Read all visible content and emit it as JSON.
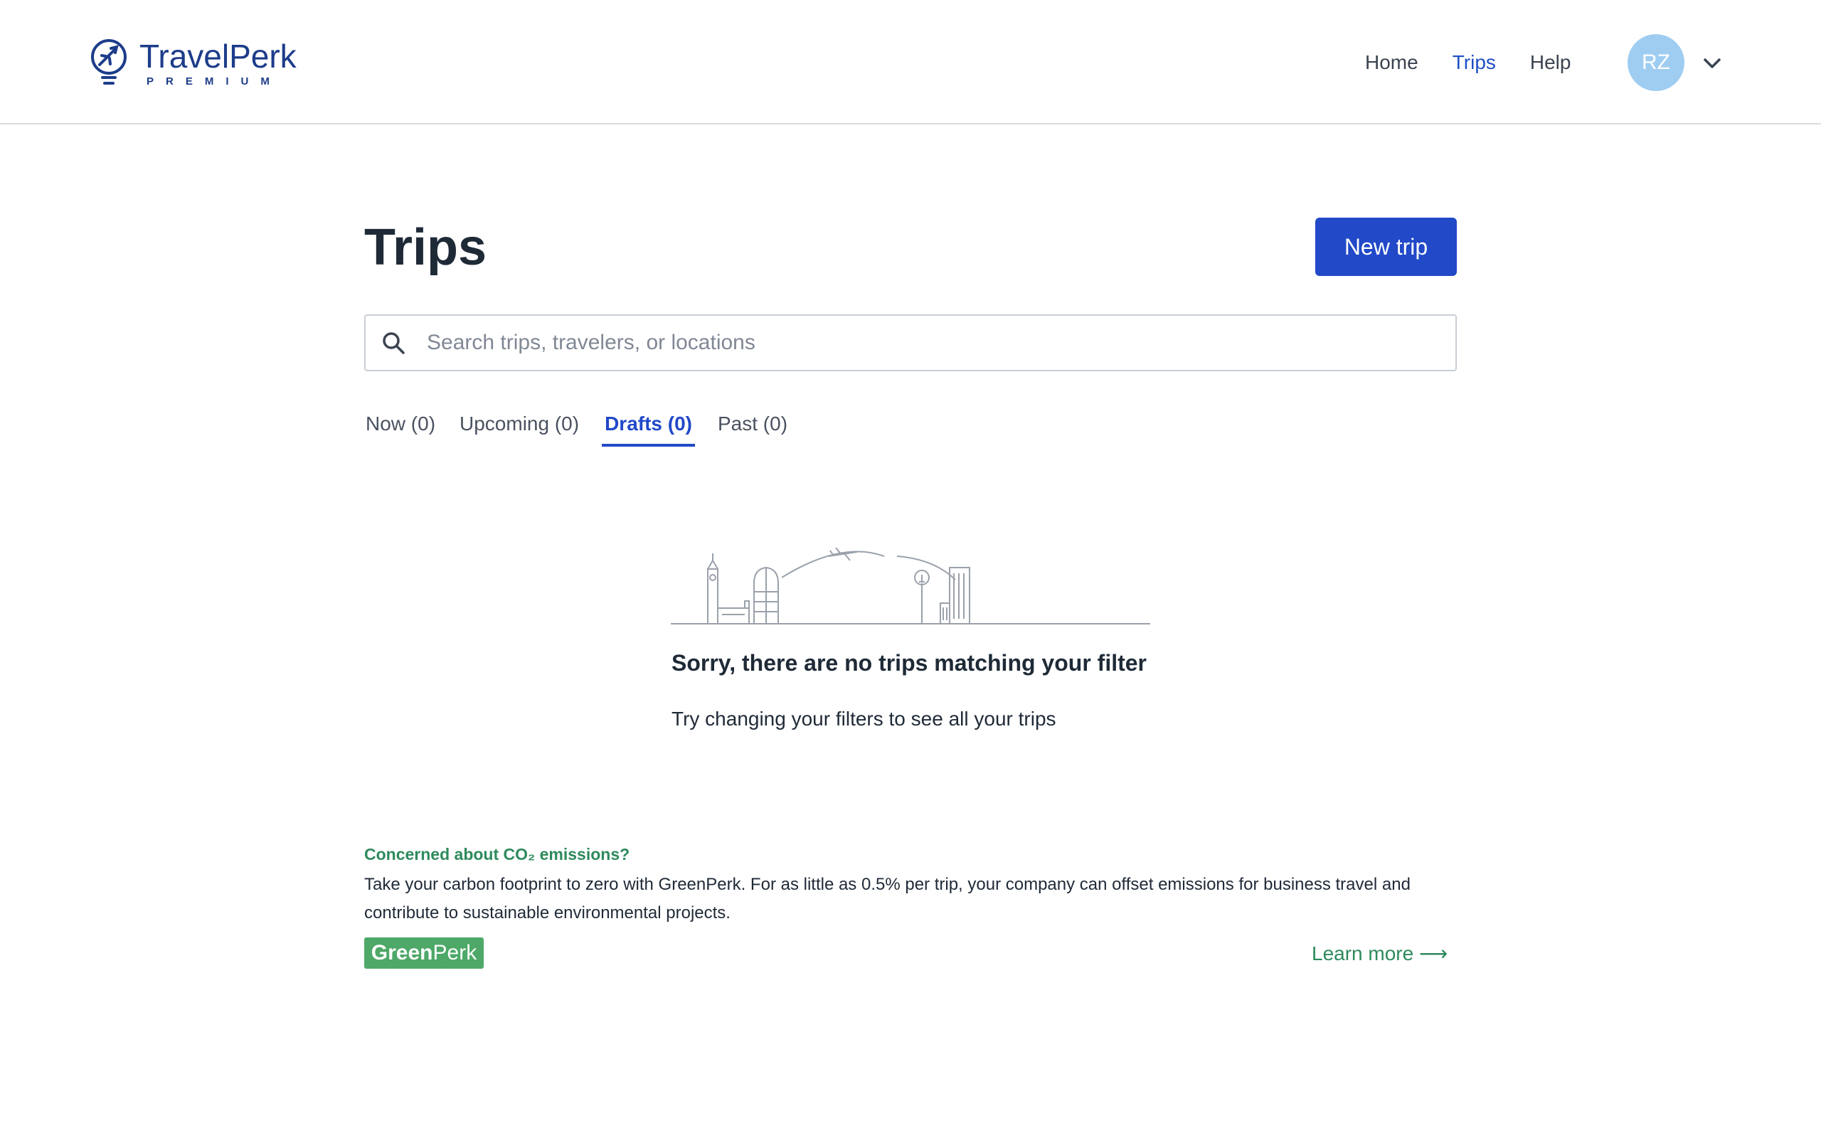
{
  "brand": {
    "name": "TravelPerk",
    "tier": "PREMIUM",
    "color": "#1d3c8a"
  },
  "nav": {
    "items": [
      {
        "label": "Home",
        "active": false
      },
      {
        "label": "Trips",
        "active": true
      },
      {
        "label": "Help",
        "active": false
      }
    ],
    "avatar_initials": "RZ",
    "avatar_color": "#9fcdf2"
  },
  "main": {
    "title": "Trips",
    "new_trip_label": "New trip",
    "search": {
      "placeholder": "Search trips, travelers, or locations",
      "value": ""
    },
    "tabs": [
      {
        "label": "Now (0)",
        "active": false
      },
      {
        "label": "Upcoming (0)",
        "active": false
      },
      {
        "label": "Drafts (0)",
        "active": true
      },
      {
        "label": "Past (0)",
        "active": false
      }
    ],
    "empty_state": {
      "title": "Sorry, there are no trips matching your filter",
      "subtitle": "Try changing your filters to see all your trips"
    }
  },
  "greenperk": {
    "heading": "Concerned about CO₂ emissions?",
    "body": "Take your carbon footprint to zero with GreenPerk. For as little as 0.5% per trip, your company can offset emissions for business travel and contribute to sustainable environmental projects.",
    "badge_strong": "Green",
    "badge_light": "Perk",
    "learn_more": "Learn more ⟶",
    "accent_color": "#2e8a5c"
  },
  "colors": {
    "primary": "#2149c8",
    "text": "#1f2a37"
  }
}
